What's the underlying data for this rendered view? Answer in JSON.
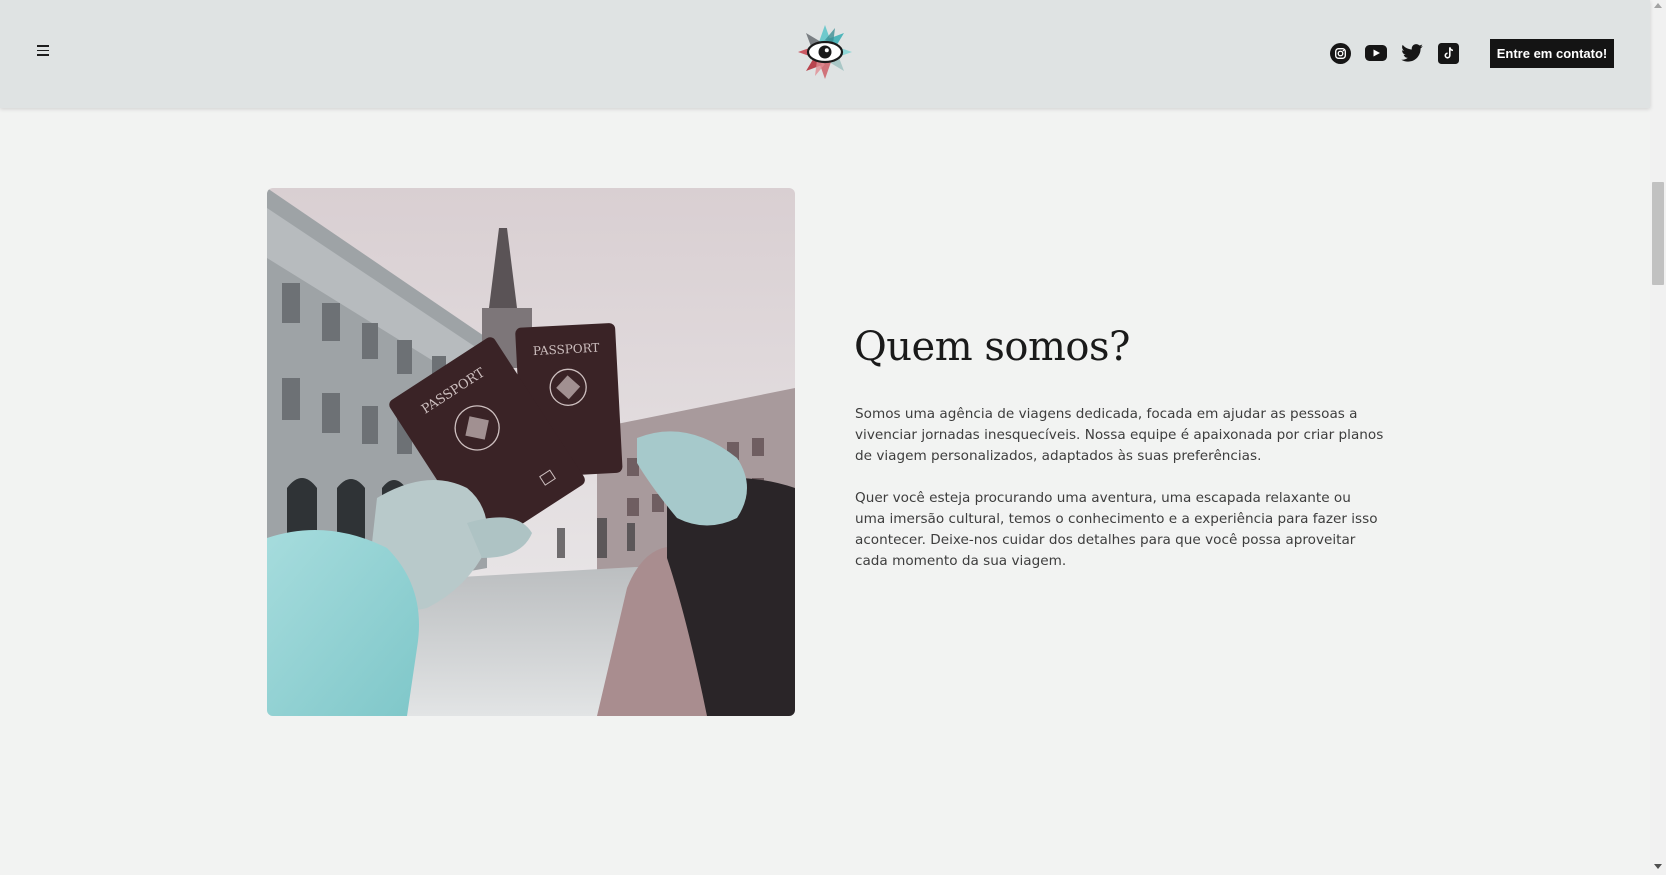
{
  "header": {
    "menu_icon": "hamburger-menu-icon",
    "logo_icon": "eye-flower-logo-icon",
    "socials": [
      {
        "name": "instagram-icon"
      },
      {
        "name": "youtube-icon"
      },
      {
        "name": "twitter-icon"
      },
      {
        "name": "tiktok-icon"
      }
    ],
    "cta_label": "Entre em contato!"
  },
  "about": {
    "image_icon": "passports-photo",
    "title": "Quem somos?",
    "paragraph1": "Somos uma agência de viagens dedicada, focada em ajudar as pessoas a vivenciar jornadas inesquecíveis. Nossa equipe é apaixonada por criar planos de viagem personalizados, adaptados às suas preferências.",
    "paragraph2": "Quer você esteja procurando uma aventura, uma escapada relaxante ou uma imersão cultural, temos o conhecimento e a experiência para fazer isso acontecer. Deixe-nos cuidar dos detalhes para que você possa aproveitar cada momento da sua viagem."
  },
  "passport_labels": [
    "PASSPORT",
    "PASSPORT"
  ],
  "colors": {
    "header_bg": "#dfe3e3",
    "page_bg": "#f2f3f2",
    "cta_bg": "#141414",
    "passport": "#3a2326",
    "accent_teal": "#7fd2d2",
    "accent_red": "#c9525a"
  }
}
